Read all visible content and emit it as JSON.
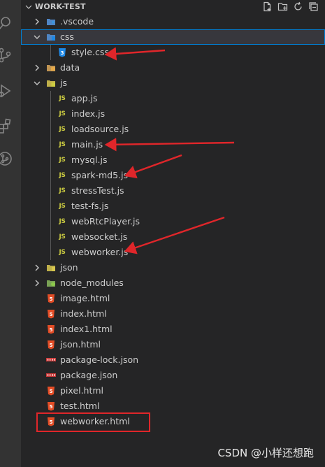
{
  "explorer": {
    "title": "WORK-TEST",
    "actions": [
      "new-file-icon",
      "new-folder-icon",
      "refresh-icon",
      "collapse-all-icon"
    ]
  },
  "activity_bar": [
    "search-icon",
    "source-control-icon",
    "run-debug-icon",
    "extensions-icon",
    "remote-icon"
  ],
  "tree": [
    {
      "label": ".vscode",
      "kind": "folder",
      "icon": "vscode-folder-icon",
      "expanded": false,
      "depth": 0
    },
    {
      "label": "css",
      "kind": "folder",
      "icon": "css-folder-icon",
      "expanded": true,
      "depth": 0,
      "selected": true
    },
    {
      "label": "style.css",
      "kind": "file",
      "icon": "css-file-icon",
      "depth": 1
    },
    {
      "label": "data",
      "kind": "folder",
      "icon": "data-folder-icon",
      "expanded": false,
      "depth": 0
    },
    {
      "label": "js",
      "kind": "folder",
      "icon": "js-folder-icon",
      "expanded": true,
      "depth": 0
    },
    {
      "label": "app.js",
      "kind": "file",
      "icon": "js-file-icon",
      "depth": 1
    },
    {
      "label": "index.js",
      "kind": "file",
      "icon": "js-file-icon",
      "depth": 1
    },
    {
      "label": "loadsource.js",
      "kind": "file",
      "icon": "js-file-icon",
      "depth": 1
    },
    {
      "label": "main.js",
      "kind": "file",
      "icon": "js-file-icon",
      "depth": 1
    },
    {
      "label": "mysql.js",
      "kind": "file",
      "icon": "js-file-icon",
      "depth": 1
    },
    {
      "label": "spark-md5.js",
      "kind": "file",
      "icon": "js-file-icon",
      "depth": 1
    },
    {
      "label": "stressTest.js",
      "kind": "file",
      "icon": "js-file-icon",
      "depth": 1
    },
    {
      "label": "test-fs.js",
      "kind": "file",
      "icon": "js-file-icon",
      "depth": 1
    },
    {
      "label": "webRtcPlayer.js",
      "kind": "file",
      "icon": "js-file-icon",
      "depth": 1
    },
    {
      "label": "websocket.js",
      "kind": "file",
      "icon": "js-file-icon",
      "depth": 1
    },
    {
      "label": "webworker.js",
      "kind": "file",
      "icon": "js-file-icon",
      "depth": 1
    },
    {
      "label": "json",
      "kind": "folder",
      "icon": "json-folder-icon",
      "expanded": false,
      "depth": 0
    },
    {
      "label": "node_modules",
      "kind": "folder",
      "icon": "node-folder-icon",
      "expanded": false,
      "depth": 0
    },
    {
      "label": "image.html",
      "kind": "file",
      "icon": "html-file-icon",
      "depth": 0
    },
    {
      "label": "index.html",
      "kind": "file",
      "icon": "html-file-icon",
      "depth": 0
    },
    {
      "label": "index1.html",
      "kind": "file",
      "icon": "html-file-icon",
      "depth": 0
    },
    {
      "label": "json.html",
      "kind": "file",
      "icon": "html-file-icon",
      "depth": 0
    },
    {
      "label": "package-lock.json",
      "kind": "file",
      "icon": "npm-file-icon",
      "depth": 0
    },
    {
      "label": "package.json",
      "kind": "file",
      "icon": "npm-file-icon",
      "depth": 0
    },
    {
      "label": "pixel.html",
      "kind": "file",
      "icon": "html-file-icon",
      "depth": 0
    },
    {
      "label": "test.html",
      "kind": "file",
      "icon": "html-file-icon",
      "depth": 0
    },
    {
      "label": "webworker.html",
      "kind": "file",
      "icon": "html-file-icon",
      "depth": 0
    }
  ],
  "annotations": {
    "arrow_targets": [
      "style.css",
      "main.js",
      "spark-md5.js",
      "webworker.js"
    ],
    "boxed_item": "webworker.html",
    "color": "#e0262a"
  },
  "colors": {
    "sidebar_bg": "#252526",
    "activity_bg": "#333333",
    "selection_outline": "#007fd4",
    "js_yellow": "#cbcb41",
    "html_orange": "#e44d26",
    "css_blue": "#42a5f5",
    "npm_red": "#cb3837"
  },
  "watermark": "CSDN @小样还想跑"
}
